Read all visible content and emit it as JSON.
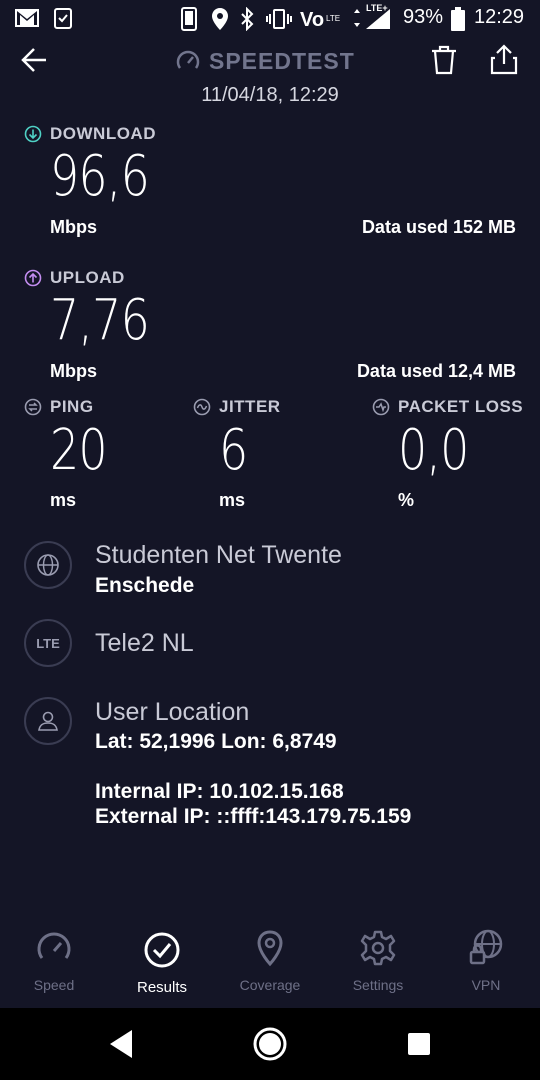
{
  "status_bar": {
    "battery": "93%",
    "time": "12:29",
    "network": "LTE+"
  },
  "header": {
    "title": "SPEEDTEST",
    "date": "11/04/18, 12:29"
  },
  "download": {
    "label": "DOWNLOAD",
    "value": "96,6",
    "unit": "Mbps",
    "data_used": "Data used 152 MB"
  },
  "upload": {
    "label": "UPLOAD",
    "value": "7,76",
    "unit": "Mbps",
    "data_used": "Data used 12,4 MB"
  },
  "ping": {
    "label": "PING",
    "value": "20",
    "unit": "ms"
  },
  "jitter": {
    "label": "JITTER",
    "value": "6",
    "unit": "ms"
  },
  "packet_loss": {
    "label": "PACKET LOSS",
    "value": "0,0",
    "unit": "%"
  },
  "server": {
    "name": "Studenten Net Twente",
    "city": "Enschede"
  },
  "carrier": {
    "badge": "LTE",
    "name": "Tele2 NL"
  },
  "location": {
    "title": "User Location",
    "coords": "Lat: 52,1996 Lon: 6,8749",
    "internal_ip": "Internal IP: 10.102.15.168",
    "external_ip": "External IP: ::ffff:143.179.75.159"
  },
  "nav": {
    "speed": "Speed",
    "results": "Results",
    "coverage": "Coverage",
    "settings": "Settings",
    "vpn": "VPN"
  },
  "colors": {
    "background": "#141526",
    "download_accent": "#4fd1c5",
    "upload_accent": "#c38df0",
    "muted": "#6e7087"
  }
}
